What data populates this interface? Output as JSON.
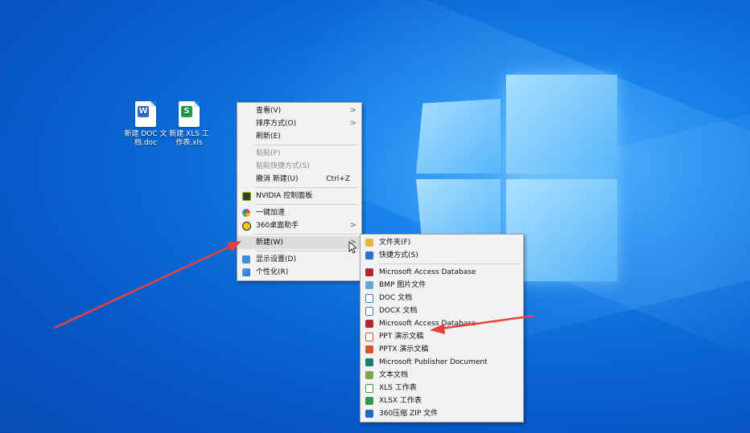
{
  "desktop_icons": [
    {
      "label": "新建 DOC 文档.doc",
      "line1": "新建 DOC 文",
      "line2": "档.doc",
      "badge": "W",
      "color": "#2b6fd6"
    },
    {
      "label": "新建 XLS 工作表.xls",
      "line1": "新建 XLS 工",
      "line2": "作表.xls",
      "badge": "S",
      "color": "#1e9e4a"
    }
  ],
  "context_menu": {
    "view": "查看(V)",
    "sort": "排序方式(O)",
    "refresh": "刷新(E)",
    "paste": "粘贴(P)",
    "paste_shortcut": "粘贴快捷方式(S)",
    "undo_new": "撤消 新建(U)",
    "undo_shortcut": "Ctrl+Z",
    "nvidia": "NVIDIA 控制面板",
    "speedup": "一键加速",
    "desktop_helper": "360桌面助手",
    "new": "新建(W)",
    "display": "显示设置(D)",
    "personalize": "个性化(R)"
  },
  "new_submenu": {
    "items": [
      {
        "label": "文件夹(F)",
        "icon": "folder-icon",
        "color": "#e8b63a"
      },
      {
        "label": "快捷方式(S)",
        "icon": "shortcut-icon",
        "color": "#2a6fd0"
      },
      {
        "label": "Microsoft Access Database",
        "icon": "access-icon",
        "color": "#b0282d"
      },
      {
        "label": "BMP 图片文件",
        "icon": "bmp-icon",
        "color": "#6aa3d8"
      },
      {
        "label": "DOC 文档",
        "icon": "doc-icon",
        "color": "#3b78d8"
      },
      {
        "label": "DOCX 文档",
        "icon": "docx-icon",
        "color": "#3b78d8"
      },
      {
        "label": "Microsoft Access Database",
        "icon": "access-icon",
        "color": "#b0282d"
      },
      {
        "label": "PPT 演示文稿",
        "icon": "ppt-icon",
        "color": "#d9542b"
      },
      {
        "label": "PPTX 演示文稿",
        "icon": "pptx-icon",
        "color": "#d9542b"
      },
      {
        "label": "Microsoft Publisher Document",
        "icon": "publisher-icon",
        "color": "#1b7f6e"
      },
      {
        "label": "文本文档",
        "icon": "text-file-icon",
        "color": "#7aa84a"
      },
      {
        "label": "XLS 工作表",
        "icon": "xls-icon",
        "color": "#2e9a4e"
      },
      {
        "label": "XLSX 工作表",
        "icon": "xlsx-icon",
        "color": "#2e9a4e"
      },
      {
        "label": "360压缩 ZIP 文件",
        "icon": "zip-icon",
        "color": "#2c66c8"
      }
    ]
  },
  "annotation_color": "#e8413a"
}
